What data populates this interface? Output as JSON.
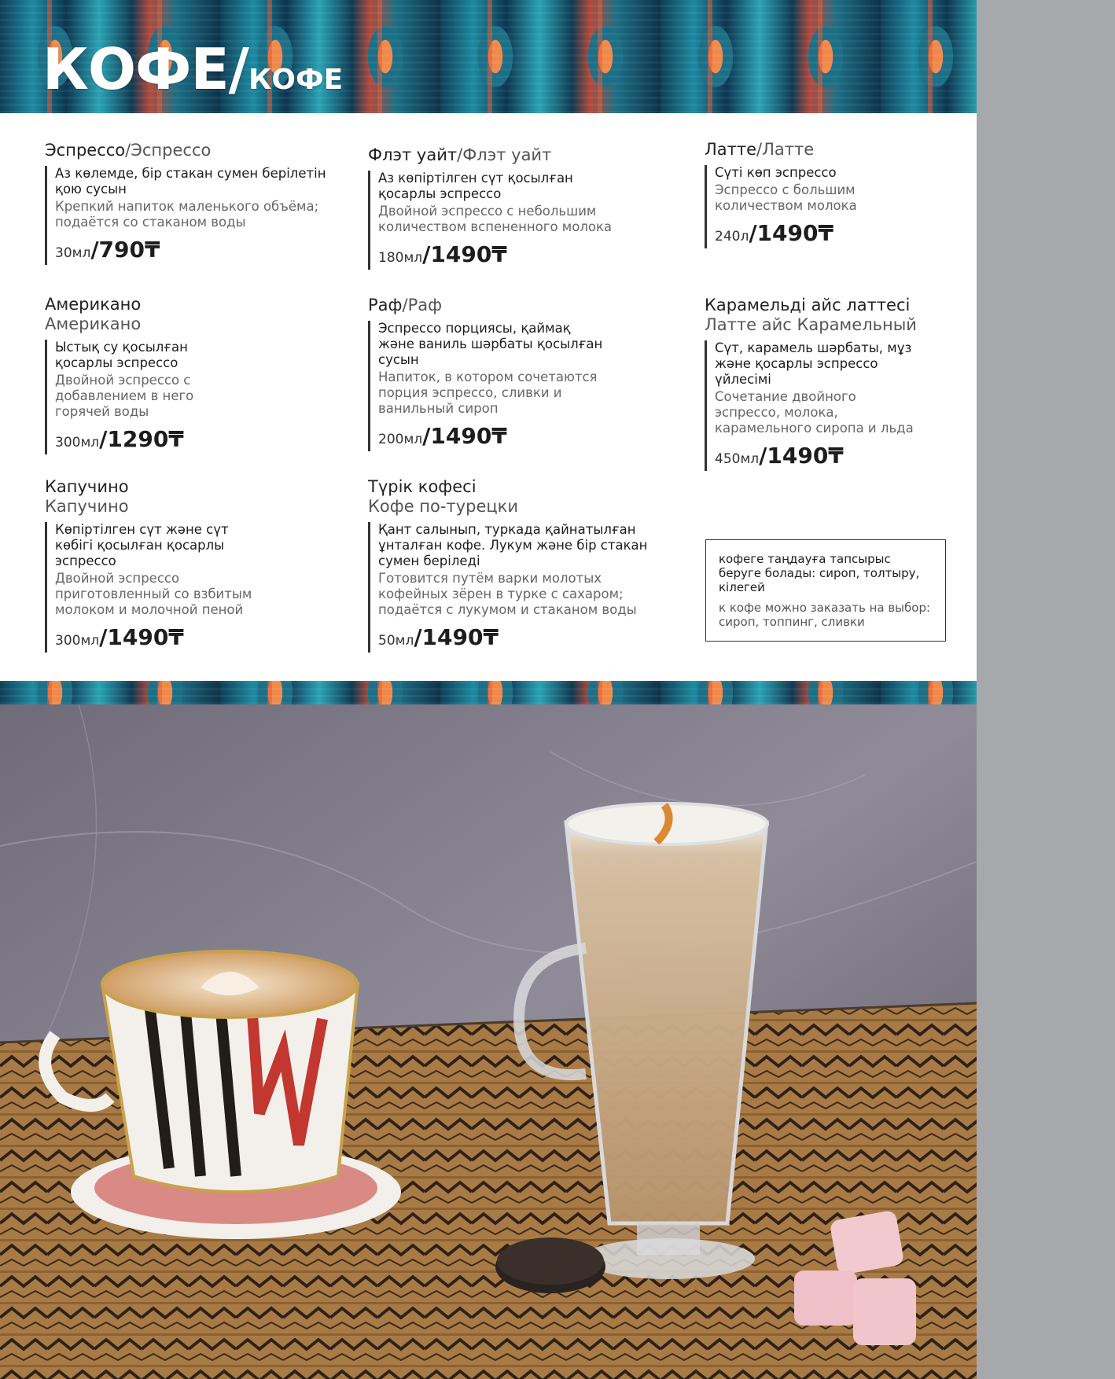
{
  "header": {
    "title_main": "КОФЕ/",
    "title_sub": "КОФЕ"
  },
  "items": [
    {
      "name_kz": "Эспрессо",
      "sep": "/",
      "name_ru": "Эспрессо",
      "desc_kz": "Аз көлемде, бір стакан сумен берілетін қою сусын",
      "desc_ru": "Крепкий напиток маленького объёма; подаётся со стаканом воды",
      "volume": "30мл",
      "price": "/790₸"
    },
    {
      "name_kz": "Флэт уайт",
      "sep": "/",
      "name_ru": "Флэт уайт",
      "desc_kz": "Аз көпіртілген сүт қосылған қосарлы эспрессо",
      "desc_ru": "Двойной эспрессо с небольшим количеством вспененного молока",
      "volume": "180мл",
      "price": "/1490₸"
    },
    {
      "name_kz": "Латте",
      "sep": "/",
      "name_ru": "Латте",
      "desc_kz": "Сүті көп эспрессо",
      "desc_ru": "Эспрессо с большим количеством молока",
      "volume": "240л",
      "price": "/1490₸"
    },
    {
      "name_kz": "Американо",
      "name_ru": "Американо",
      "desc_kz": "Ыстық су қосылған қосарлы эспрессо",
      "desc_ru": "Двойной эспрессо с добавлением в него горячей воды",
      "volume": "300мл",
      "price": "/1290₸"
    },
    {
      "name_kz": "Раф",
      "sep": "/",
      "name_ru": "Раф",
      "desc_kz": "Эспрессо порциясы, қаймақ және ваниль шәрбаты қосылған сусын",
      "desc_ru": "Напиток, в котором сочетаются порция эспрессо, сливки и ванильный сироп",
      "volume": "200мл",
      "price": "/1490₸"
    },
    {
      "name_kz": "Карамельді айс латтесі",
      "name_ru": "Латте айс Карамельный",
      "desc_kz": "Сүт, карамель шәрбаты, мұз және қосарлы эспрессо үйлесімі",
      "desc_ru": "Сочетание двойного эспрессо, молока, карамельного сиропа и льда",
      "volume": "450мл",
      "price": "/1490₸"
    },
    {
      "name_kz": "Капучино",
      "name_ru": "Капучино",
      "desc_kz": "Көпіртілген сүт және сүт көбігі қосылған қосарлы эспрессо",
      "desc_ru": "Двойной эспрессо приготовленный со взбитым молоком и молочной пеной",
      "volume": "300мл",
      "price": "/1490₸"
    },
    {
      "name_kz": "Түрік кофесі",
      "name_ru": "Кофе по-турецки",
      "desc_kz": "Қант салынып, туркада қайнатылған ұнталған кофе. Лукум және бір стакан сумен беріледі",
      "desc_ru": "Готовится путём варки молотых кофейных зёрен в турке с сахаром; подаётся с лукумом и стаканом воды",
      "volume": "50мл",
      "price": "/1490₸"
    }
  ],
  "note": {
    "kz": "кофеге таңдауға тапсырыс беруге болады: сироп, толтыру, кілегей",
    "ru": "к кофе можно заказать на выбор: сироп, топпинг, сливки"
  },
  "colors": {
    "banner_blue": "#1d8aa1",
    "banner_orange": "#f08a4b",
    "side_gray": "#a7a8ab",
    "text": "#1f1f1f"
  }
}
